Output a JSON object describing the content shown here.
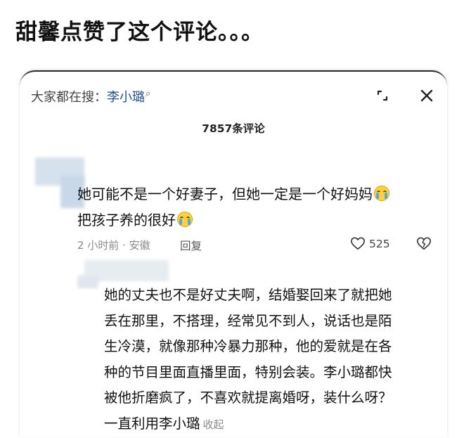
{
  "headline": "甜馨点赞了这个评论。。。",
  "panel": {
    "search_prefix": "大家都在搜：",
    "search_term": "李小璐",
    "comment_count": "7857条评论"
  },
  "comment1": {
    "line1": "她可能不是一个好妻子，但她一定是一个好妈妈",
    "line2": "把孩子养的很好",
    "emoji": "crying-face",
    "meta": "2 小时前 · 安徽",
    "reply_label": "回复",
    "likes": "525"
  },
  "comment2": {
    "lines": [
      "她的丈夫也不是好丈夫啊，结婚娶回来了就把她",
      "丢在那里，不搭理，经常见不到人，说话也是陌",
      "生冷漠，就像那种冷暴力那种，他的爱就是在各",
      "种的节目里面直播里面，特别会装。李小璐都快",
      "被他折磨疯了，不喜欢就提离婚呀，装什么呀？",
      "一直利用李小璐"
    ],
    "collapse_label": "收起"
  },
  "colors": {
    "search_term": "#1f4e8c",
    "meta_gray": "#8a8a8a",
    "emoji_yellow": "#ffd23d"
  }
}
